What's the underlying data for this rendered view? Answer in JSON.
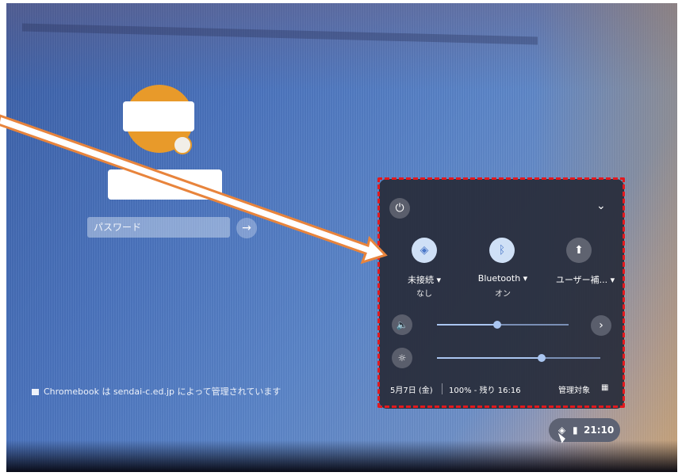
{
  "login": {
    "password_placeholder": "パスワード",
    "submit_icon": "→",
    "managed_notice": "Chromebook は sendai-c.ed.jp によって管理されています"
  },
  "quick_settings": {
    "power_icon": "⏻",
    "collapse_icon": "⌄",
    "features": [
      {
        "name": "wifi",
        "icon": "◈",
        "label": "未接続 ▾",
        "sub": "なし",
        "active": true
      },
      {
        "name": "bluetooth",
        "icon": "ᛒ",
        "label": "Bluetooth ▾",
        "sub": "オン",
        "active": true
      },
      {
        "name": "user",
        "icon": "⬆",
        "label": "ユーザー補... ▾",
        "sub": "",
        "active": false
      }
    ],
    "volume": {
      "icon": "🔈",
      "level": 0.46
    },
    "brightness": {
      "icon": "☼",
      "level": 0.64
    },
    "more_icon": "›",
    "date": "5月7日 (金)",
    "battery": "100% - 残り 16:16",
    "managed_label": "管理対象",
    "managed_icon": "▦"
  },
  "tray": {
    "wifi_icon": "◈",
    "battery_icon": "▮",
    "time": "21:10"
  },
  "colors": {
    "annotation_frame": "#e3191e",
    "arrow_fill": "#ffffff",
    "arrow_outline": "#e8843c",
    "avatar": "#e89a2a"
  }
}
